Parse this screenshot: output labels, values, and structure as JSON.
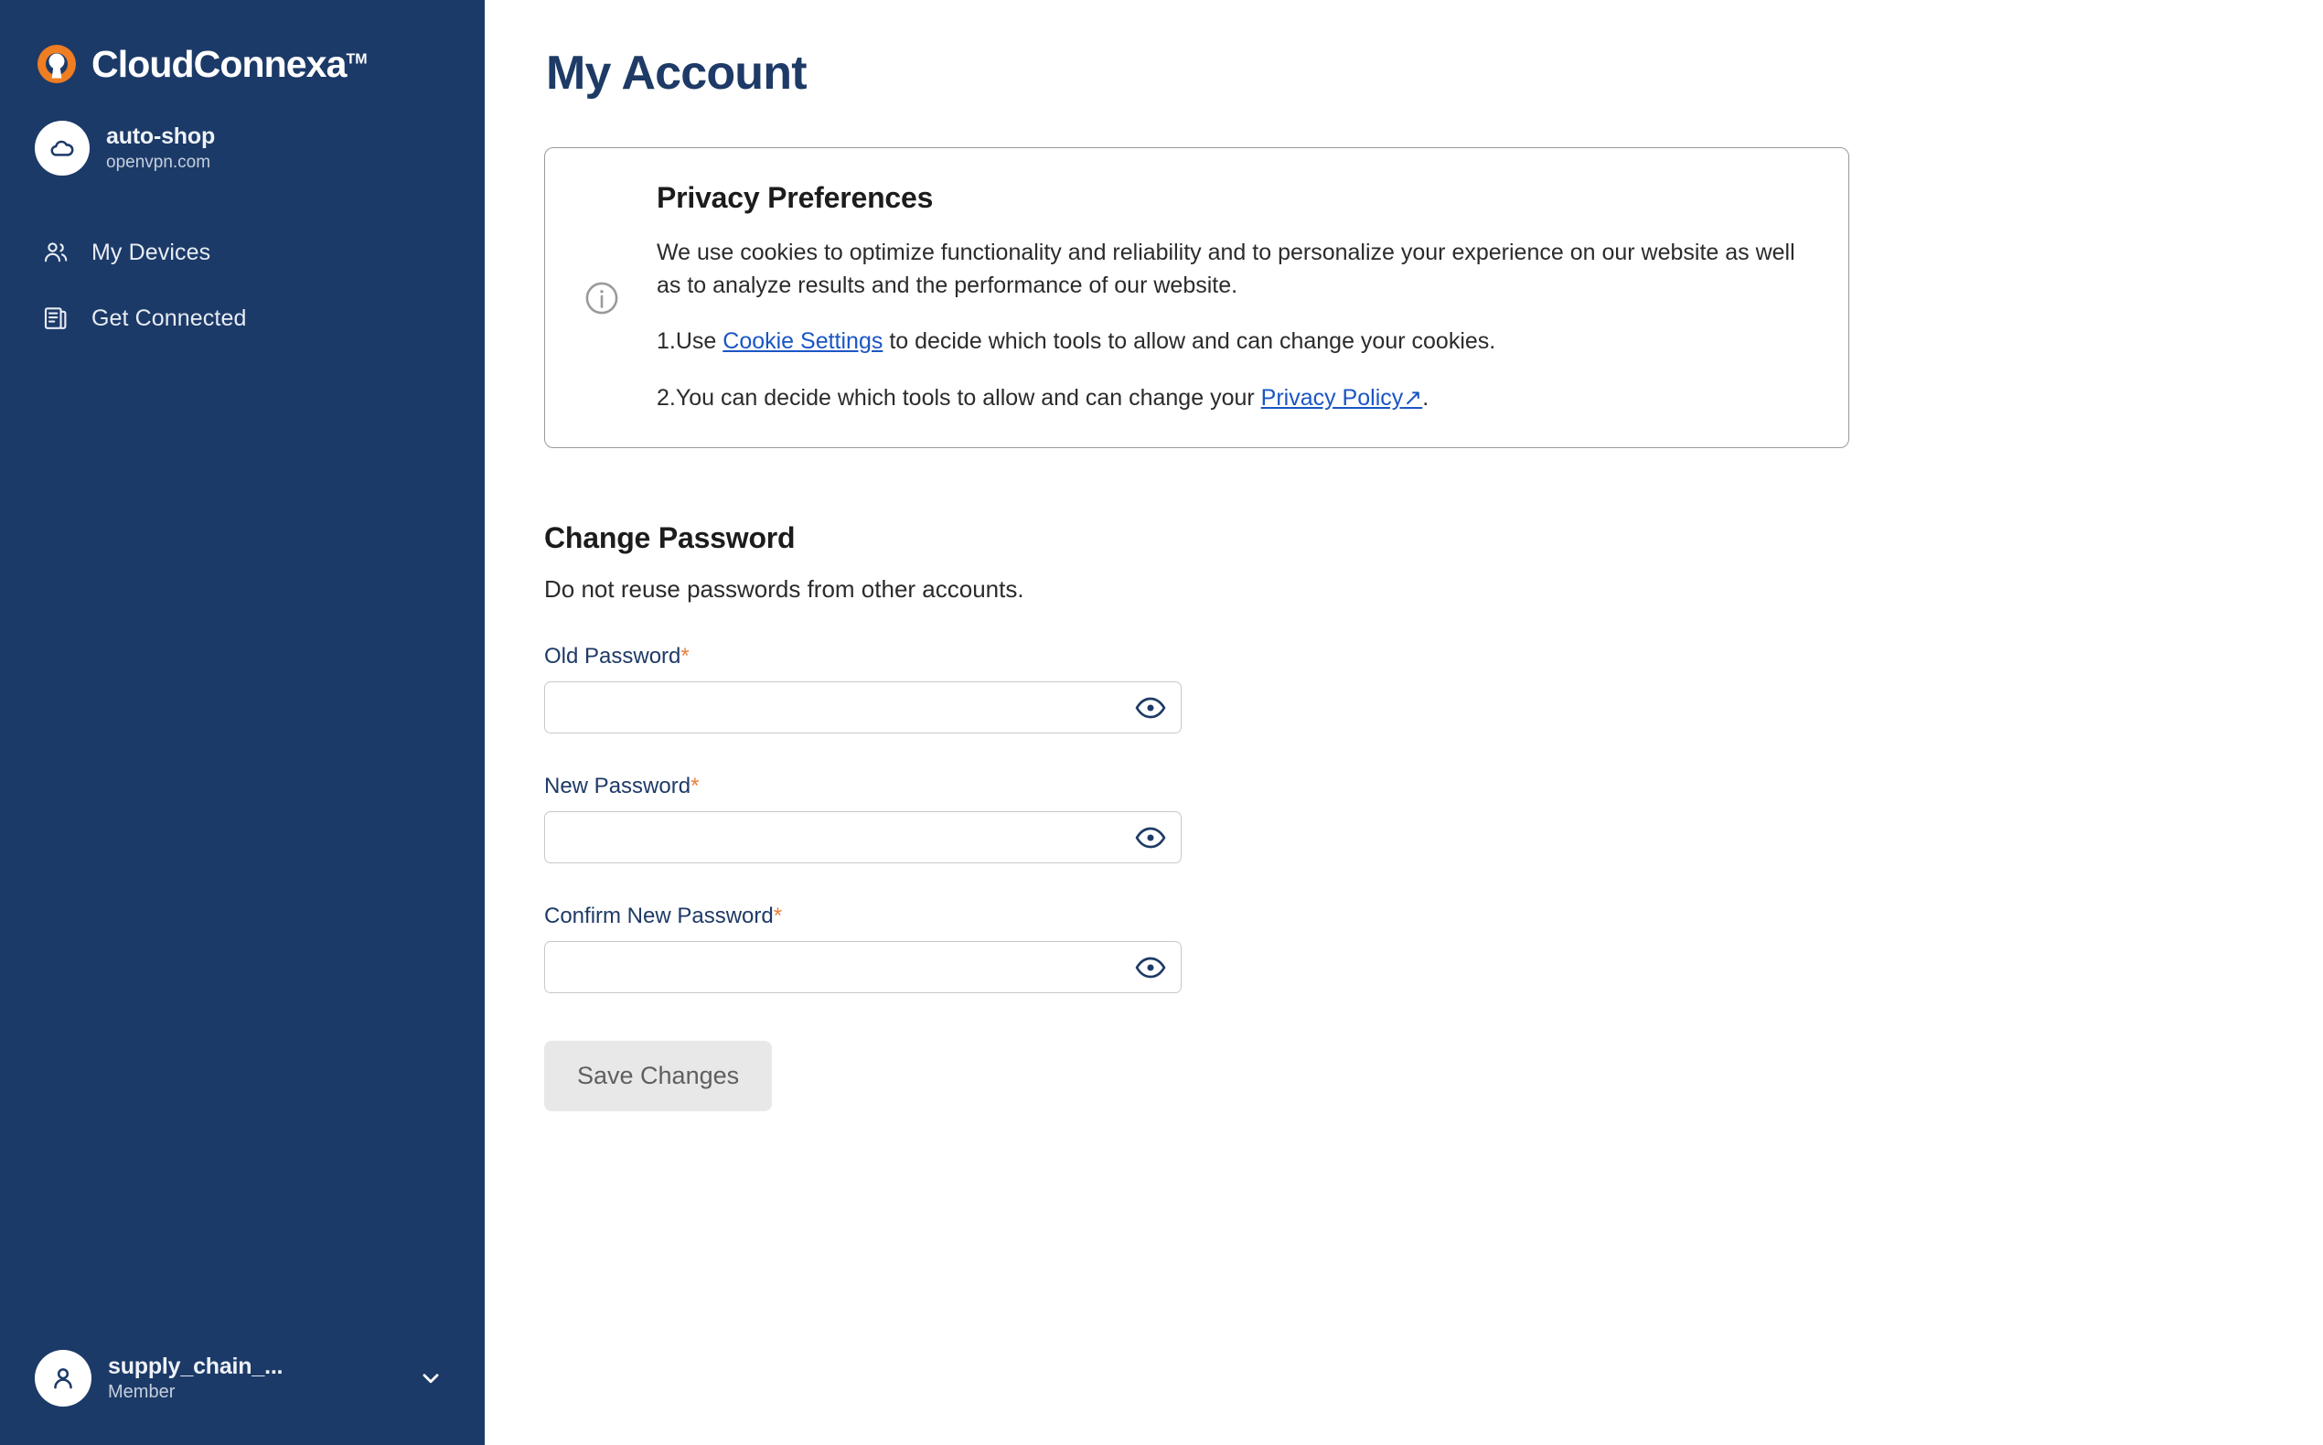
{
  "brand": {
    "product_name": "CloudConnexa",
    "trademark": "TM",
    "logo_orange": "#ef7d22",
    "sidebar_bg": "#1c3a68"
  },
  "sidebar": {
    "org": {
      "name": "auto-shop",
      "domain": "openvpn.com",
      "avatar_icon": "cloud-icon"
    },
    "items": [
      {
        "label": "My Devices",
        "icon": "users-icon"
      },
      {
        "label": "Get Connected",
        "icon": "document-list-icon"
      }
    ],
    "user": {
      "name": "supply_chain_...",
      "role": "Member",
      "avatar_icon": "person-icon",
      "chevron_icon": "chevron-down-icon"
    }
  },
  "main": {
    "page_title": "My Account",
    "privacy_card": {
      "info_icon": "info-circle-icon",
      "title": "Privacy Preferences",
      "paragraph": "We use cookies to optimize functionality and reliability and to personalize your experience on our website as well as to analyze results and the performance of our website.",
      "list": [
        {
          "number": "1.",
          "before": "Use ",
          "link": "Cookie Settings",
          "after": " to decide which tools to allow and can change your cookies."
        },
        {
          "number": "2.",
          "before": "You can decide which tools to allow and can change your ",
          "link": "Privacy Policy",
          "link_icon": "↗",
          "after": "."
        }
      ],
      "link_color": "#1a56c4"
    },
    "change_password": {
      "title": "Change Password",
      "subtitle": "Do not reuse passwords from other accounts.",
      "required_marker": "*",
      "fields": [
        {
          "label": "Old Password",
          "value": "",
          "placeholder": "",
          "toggle_icon": "eye-icon"
        },
        {
          "label": "New Password",
          "value": "",
          "placeholder": "",
          "toggle_icon": "eye-icon"
        },
        {
          "label": "Confirm New Password",
          "value": "",
          "placeholder": "",
          "toggle_icon": "eye-icon"
        }
      ],
      "save_label": "Save Changes"
    }
  }
}
